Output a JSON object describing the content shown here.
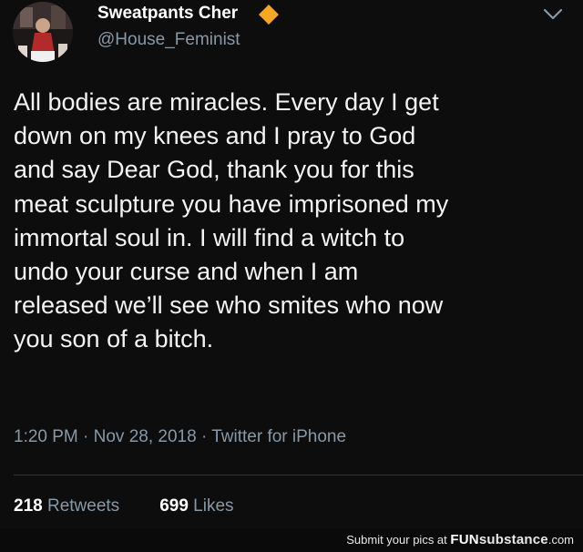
{
  "tweet": {
    "display_name": "Sweatpants Cher",
    "handle": "@House_Feminist",
    "verified_icon": "verified-badge-icon",
    "verified_color": "#f5a623",
    "menu_icon": "chevron-down-icon",
    "avatar_icon": "profile-avatar",
    "body_lines": [
      "All bodies are miracles. Every day I get",
      "down on my knees and I pray to God",
      "and say Dear God, thank you for this",
      "meat sculpture you have imprisoned my",
      "immortal soul in. I will find a witch to",
      "undo your curse and when I am",
      "released we’ll see who smites who now",
      "you son of a bitch."
    ],
    "timestamp": "1:20 PM · Nov 28, 2018 · Twitter for iPhone",
    "stats": {
      "retweets_count": "218",
      "retweets_label": "Retweets",
      "likes_count": "699",
      "likes_label": "Likes"
    }
  },
  "footer": {
    "prefix": "Submit your pics at ",
    "brand_part1": "FUN",
    "brand_part2": "substance",
    "brand_suffix": ".com"
  },
  "colors": {
    "background": "#0d0d0e",
    "secondary_text": "#8899a6",
    "primary_text": "#ffffff"
  }
}
